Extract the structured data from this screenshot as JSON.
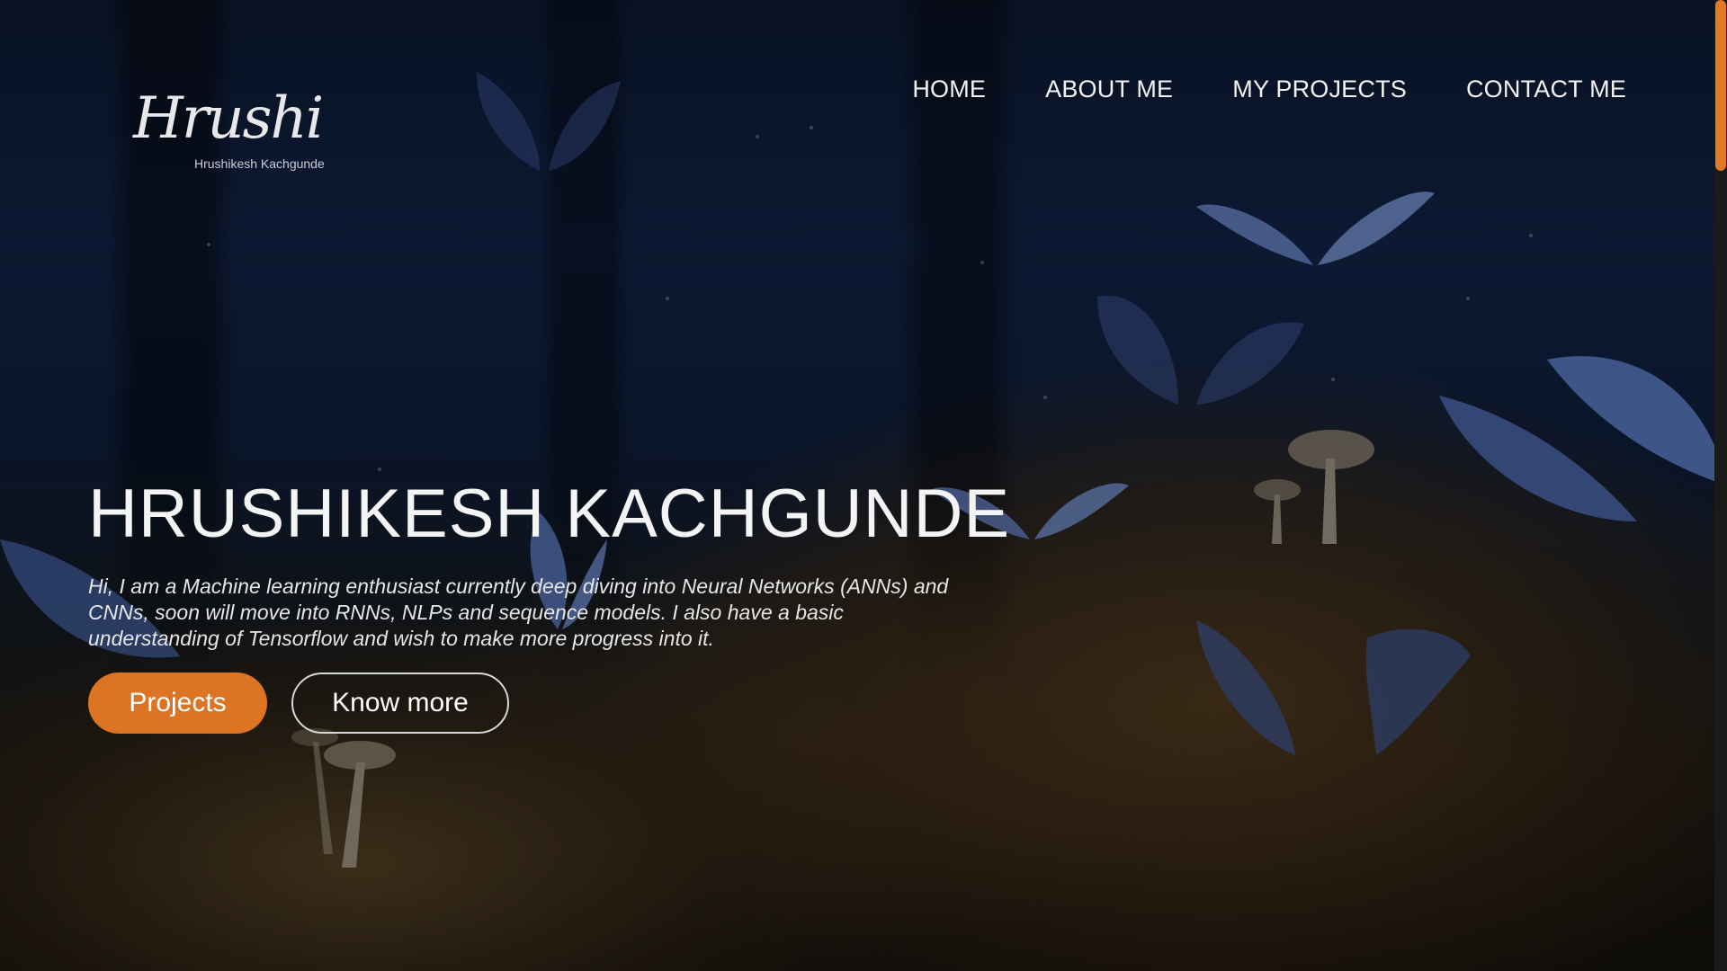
{
  "logo": {
    "script_text": "Hrushi",
    "subtitle": "Hrushikesh Kachgunde"
  },
  "nav": {
    "items": [
      {
        "label": "HOME"
      },
      {
        "label": "ABOUT ME"
      },
      {
        "label": "MY PROJECTS"
      },
      {
        "label": "CONTACT ME"
      }
    ]
  },
  "hero": {
    "title": "HRUSHIKESH KACHGUNDE",
    "description": "Hi, I am a Machine learning enthusiast currently deep diving into Neural Networks (ANNs) and CNNs, soon will move into RNNs, NLPs and sequence models. I also have a basic understanding of Tensorflow and wish to make more progress into it.",
    "primary_button": "Projects",
    "secondary_button": "Know more"
  },
  "colors": {
    "accent": "#dd7424",
    "text": "#f4f4f4"
  }
}
